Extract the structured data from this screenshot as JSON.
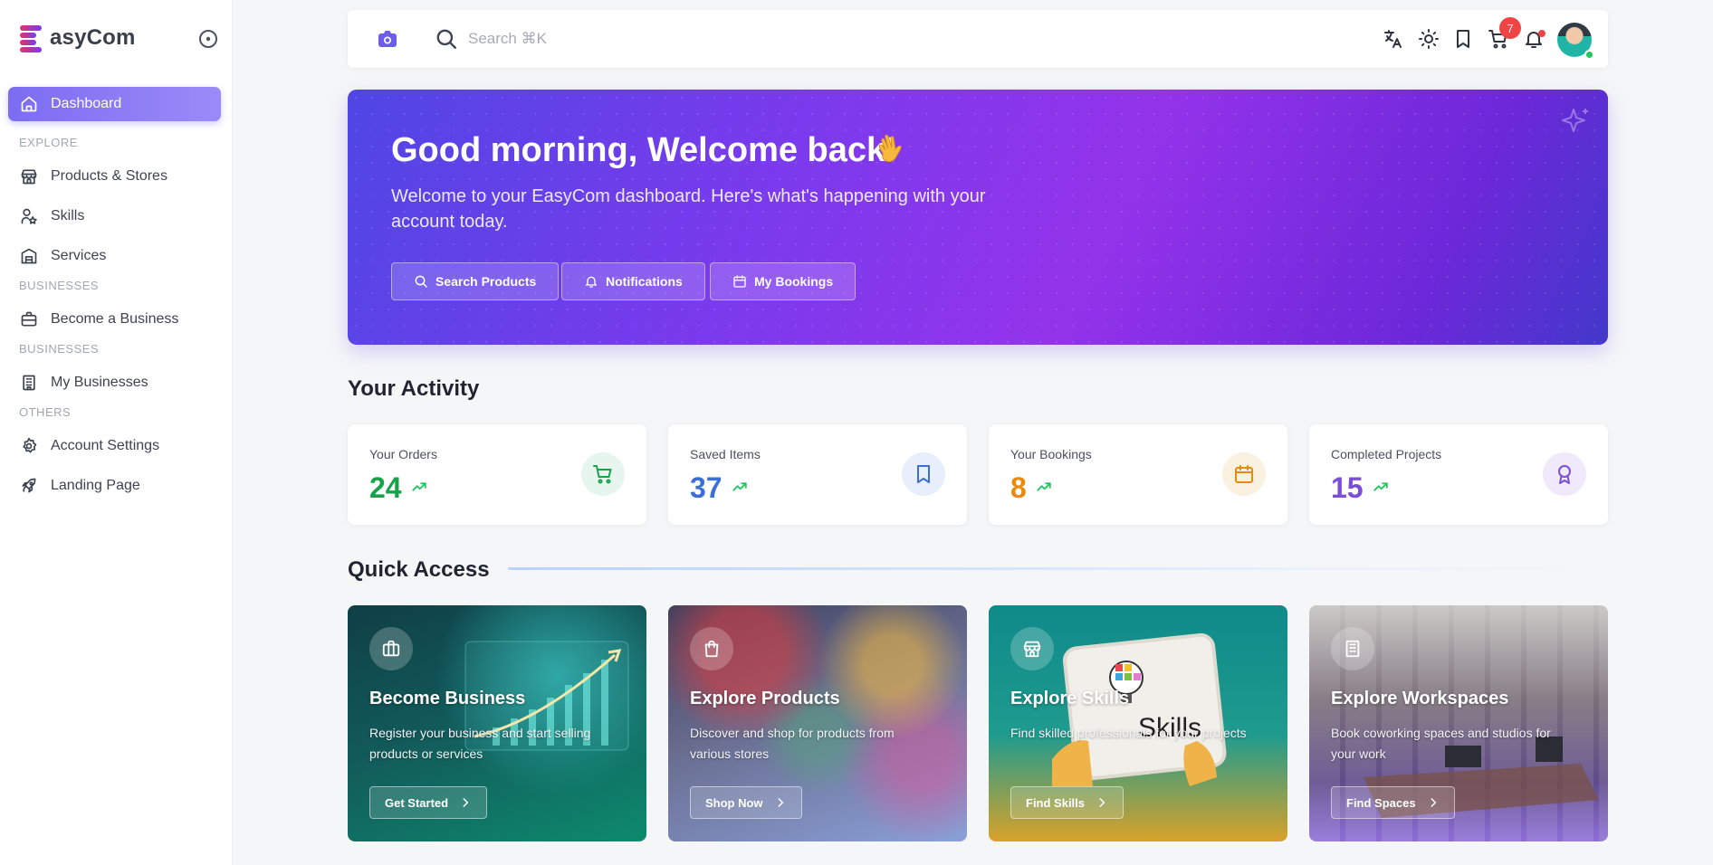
{
  "brand": {
    "name": "asyCom"
  },
  "sidebar": {
    "dashboard": "Dashboard",
    "section_explore": "EXPLORE",
    "products_stores": "Products & Stores",
    "skills": "Skills",
    "services": "Services",
    "section_businesses_1": "BUSINESSES",
    "become_business": "Become a Business",
    "section_businesses_2": "BUSINESSES",
    "my_businesses": "My Businesses",
    "section_others": "OTHERS",
    "account_settings": "Account Settings",
    "landing_page": "Landing Page"
  },
  "topbar": {
    "search_placeholder": "Search ⌘K",
    "cart_count": "7"
  },
  "hero": {
    "title": "Good morning, Welcome back!",
    "subtitle": "Welcome to your EasyCom dashboard. Here's what's happening with your account today.",
    "btn_search": "Search Products",
    "btn_notifications": "Notifications",
    "btn_bookings": "My Bookings"
  },
  "activity": {
    "title": "Your Activity",
    "cards": [
      {
        "label": "Your Orders",
        "value": "24",
        "color": "#16a34a",
        "icon": "cart-icon"
      },
      {
        "label": "Saved Items",
        "value": "37",
        "color": "#3b6fd8",
        "icon": "bookmark-icon"
      },
      {
        "label": "Your Bookings",
        "value": "8",
        "color": "#ea8a0c",
        "icon": "calendar-icon"
      },
      {
        "label": "Completed Projects",
        "value": "15",
        "color": "#7c4dd8",
        "icon": "award-icon"
      }
    ]
  },
  "quick_access": {
    "title": "Quick Access",
    "cards": [
      {
        "title": "Become Business",
        "desc": "Register your business and start selling products or services",
        "button": "Get Started",
        "icon": "briefcase-icon"
      },
      {
        "title": "Explore Products",
        "desc": "Discover and shop for products from various stores",
        "button": "Shop Now",
        "icon": "shopping-bag-icon"
      },
      {
        "title": "Explore Skills",
        "desc": "Find skilled professionals for your projects",
        "button": "Find Skills",
        "icon": "store-icon",
        "image_text": "Skills"
      },
      {
        "title": "Explore Workspaces",
        "desc": "Book coworking spaces and studios for your work",
        "button": "Find Spaces",
        "icon": "building-icon"
      }
    ]
  }
}
